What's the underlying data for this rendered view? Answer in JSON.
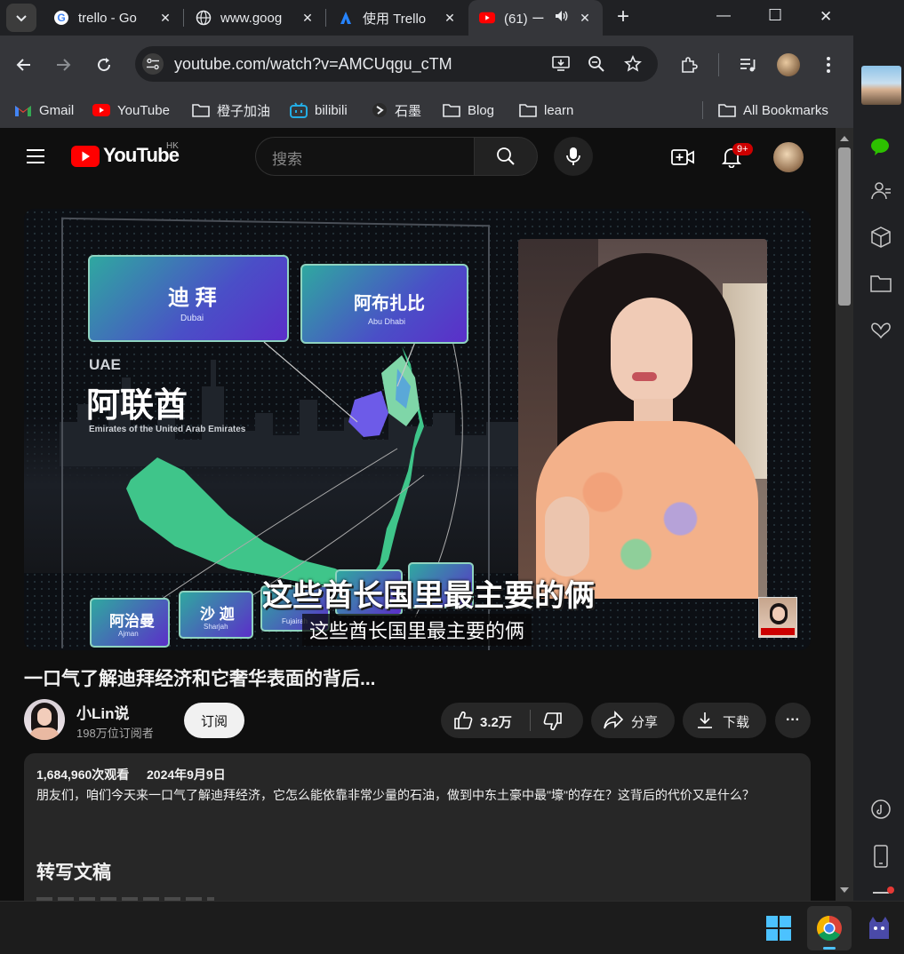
{
  "tabs": [
    {
      "title": "trello - Go",
      "close": "✕"
    },
    {
      "title": "www.goog",
      "close": "✕"
    },
    {
      "title": "使用 Trello",
      "close": "✕"
    },
    {
      "title": "(61) ー",
      "close": "✕"
    }
  ],
  "window": {
    "new_tab": "+",
    "minimize": "—",
    "maximize": "☐",
    "close": "✕"
  },
  "address": {
    "url": "youtube.com/watch?v=AMCUqgu_cTM"
  },
  "bookmarks": [
    {
      "label": "Gmail"
    },
    {
      "label": "YouTube"
    },
    {
      "label": "橙子加油"
    },
    {
      "label": "bilibili"
    },
    {
      "label": "石墨"
    },
    {
      "label": "Blog"
    },
    {
      "label": "learn"
    }
  ],
  "all_bookmarks": "All Bookmarks",
  "yt": {
    "logo_text": "YouTube",
    "region": "HK",
    "search_placeholder": "搜索",
    "notif_badge": "9+"
  },
  "video": {
    "map_labels": {
      "dubai_cn": "迪 拜",
      "dubai_en": "Dubai",
      "abudhabi_cn": "阿布扎比",
      "abudhabi_en": "Abu Dhabi",
      "uae": "UAE",
      "uae_cn": "阿联酋",
      "uae_en": "Emirates of the United Arab Emirates",
      "ajman_cn": "阿治曼",
      "ajman_en": "Ajman",
      "sharjah_cn": "沙 迦",
      "sharjah_en": "Sharjah",
      "fujairah_en": "Fujairah"
    },
    "burned_subtitle": "这些酋长国里最主要的俩",
    "caption": "这些酋长国里最主要的俩"
  },
  "title": "一口气了解迪拜经济和它奢华表面的背后...",
  "channel": {
    "name": "小Lin说",
    "subs": "198万位订阅者",
    "subscribe": "订阅"
  },
  "actions": {
    "likes": "3.2万",
    "share": "分享",
    "download": "下载",
    "more": "···"
  },
  "description": {
    "views": "1,684,960次观看",
    "date": "2024年9月9日",
    "text": "朋友们，咱们今天来一口气了解迪拜经济，它怎么能依靠非常少量的石油，做到中东土豪中最\"壕\"的存在？这背后的代价又是什么？",
    "transcript_title": "转写文稿"
  },
  "colors": {
    "yt_red": "#ff0000",
    "map_green": "#3fc58a",
    "panel_purple": "#5b3fd1",
    "chrome_dark": "#202124",
    "chrome_toolbar": "#35363a"
  }
}
